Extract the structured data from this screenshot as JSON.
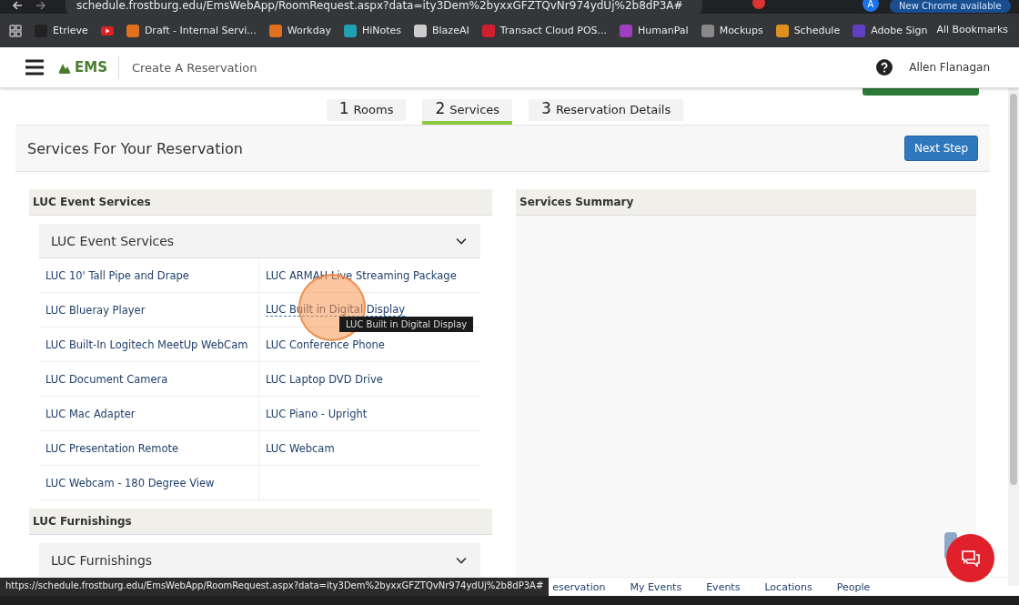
{
  "browser": {
    "url": "schedule.frostburg.edu/EmsWebApp/RoomRequest.aspx?data=ity3Dem%2byxxGFZTQvNr974ydUj%2b8dP3A#",
    "profile": "A",
    "update_label": "New Chrome available",
    "bookmarks": [
      {
        "label": "Etrieve",
        "color": "#222222"
      },
      {
        "kind": "icon",
        "color": "#e02020"
      },
      {
        "label": "Draft - Internal Servi...",
        "color": "#e07020"
      },
      {
        "label": "Workday",
        "color": "#e07020"
      },
      {
        "label": "HiNotes",
        "color": "#20a0b0"
      },
      {
        "label": "BlazeAI",
        "color": "#cccccc"
      },
      {
        "label": "Transact Cloud POS...",
        "color": "#d02030"
      },
      {
        "label": "HumanPal",
        "color": "#a040c0"
      },
      {
        "label": "Mockups",
        "color": "#888888"
      },
      {
        "label": "Schedule",
        "color": "#e09020"
      },
      {
        "label": "Adobe Sign",
        "color": "#6040c0"
      }
    ],
    "all_bookmarks": "All Bookmarks"
  },
  "app_header": {
    "brand": "EMS",
    "title": "Create A Reservation",
    "user": "Allen Flanagan"
  },
  "steps": [
    {
      "number": "1",
      "label": "Rooms",
      "selected": false
    },
    {
      "number": "2",
      "label": "Services",
      "selected": true
    },
    {
      "number": "3",
      "label": "Reservation Details",
      "selected": false
    }
  ],
  "panel": {
    "title": "Services For Your Reservation",
    "next_button": "Next Step"
  },
  "sections": [
    {
      "title": "LUC Event Services",
      "groups": [
        {
          "title": "LUC Event Services",
          "items": [
            {
              "label": "LUC 10' Tall Pipe and Drape",
              "hovered": false
            },
            {
              "label": "LUC ARMAH Live Streaming Package",
              "hovered": false
            },
            {
              "label": "LUC Blueray Player",
              "hovered": false
            },
            {
              "label": "LUC Built in Digital Display",
              "hovered": true,
              "tooltip": "LUC Built in Digital Display"
            },
            {
              "label": "LUC Built-In Logitech MeetUp WebCam",
              "hovered": false
            },
            {
              "label": "LUC Conference Phone",
              "hovered": false
            },
            {
              "label": "LUC Document Camera",
              "hovered": false
            },
            {
              "label": "LUC Laptop DVD Drive",
              "hovered": false
            },
            {
              "label": "LUC Mac Adapter",
              "hovered": false
            },
            {
              "label": "LUC Piano - Upright",
              "hovered": false
            },
            {
              "label": "LUC Presentation Remote",
              "hovered": false
            },
            {
              "label": "LUC Webcam",
              "hovered": false
            },
            {
              "label": "LUC Webcam - 180 Degree View",
              "hovered": false
            }
          ]
        }
      ]
    },
    {
      "title": "LUC Furnishings",
      "groups": [
        {
          "title": "LUC Furnishings"
        }
      ]
    }
  ],
  "summary": {
    "title": "Services Summary"
  },
  "status_url": "https://schedule.frostburg.edu/EmsWebApp/RoomRequest.aspx?data=ity3Dem%2byxxGFZTQvNr974ydUj%2b8dP3A#",
  "footer_links": [
    "eservation",
    "My Events",
    "Events",
    "Locations",
    "People"
  ]
}
